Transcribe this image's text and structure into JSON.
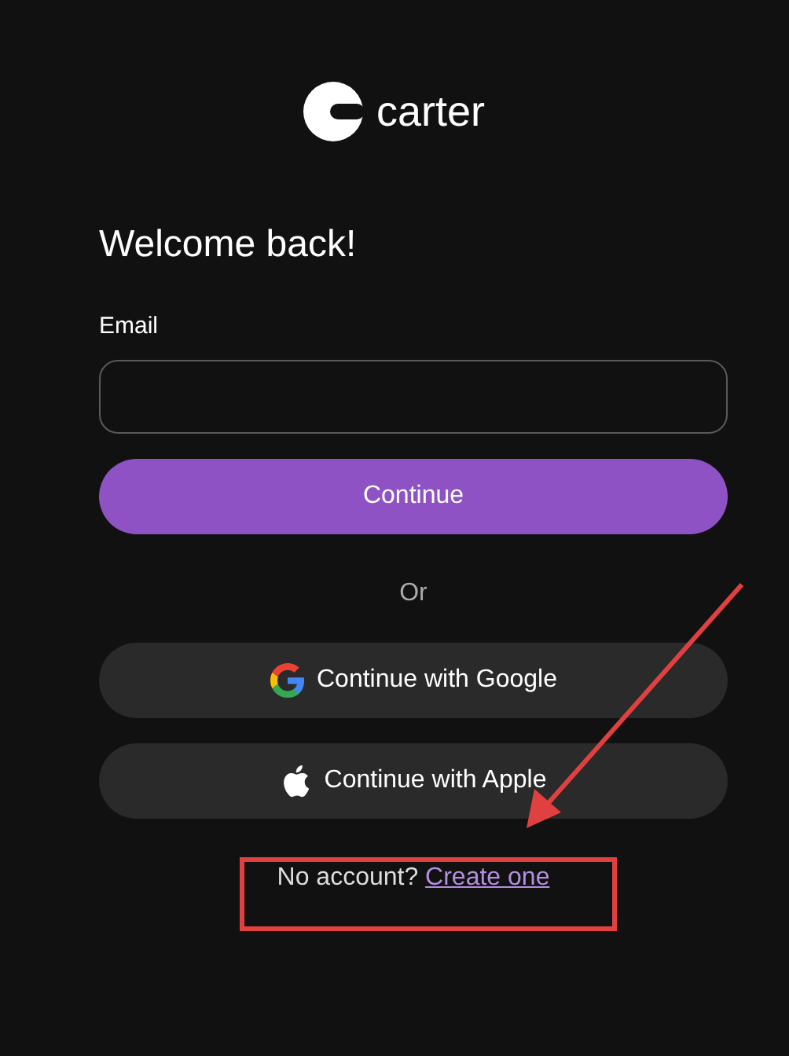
{
  "logo": {
    "text": "carter"
  },
  "heading": "Welcome back!",
  "email_field": {
    "label": "Email"
  },
  "continue_button": "Continue",
  "divider_text": "Or",
  "social_buttons": [
    {
      "kind": "google",
      "label": "Continue with Google"
    },
    {
      "kind": "apple",
      "label": "Continue with Apple"
    }
  ],
  "signup": {
    "text": "No account?",
    "link": "Create one"
  },
  "annotations": {
    "arrow": true,
    "box": true
  }
}
